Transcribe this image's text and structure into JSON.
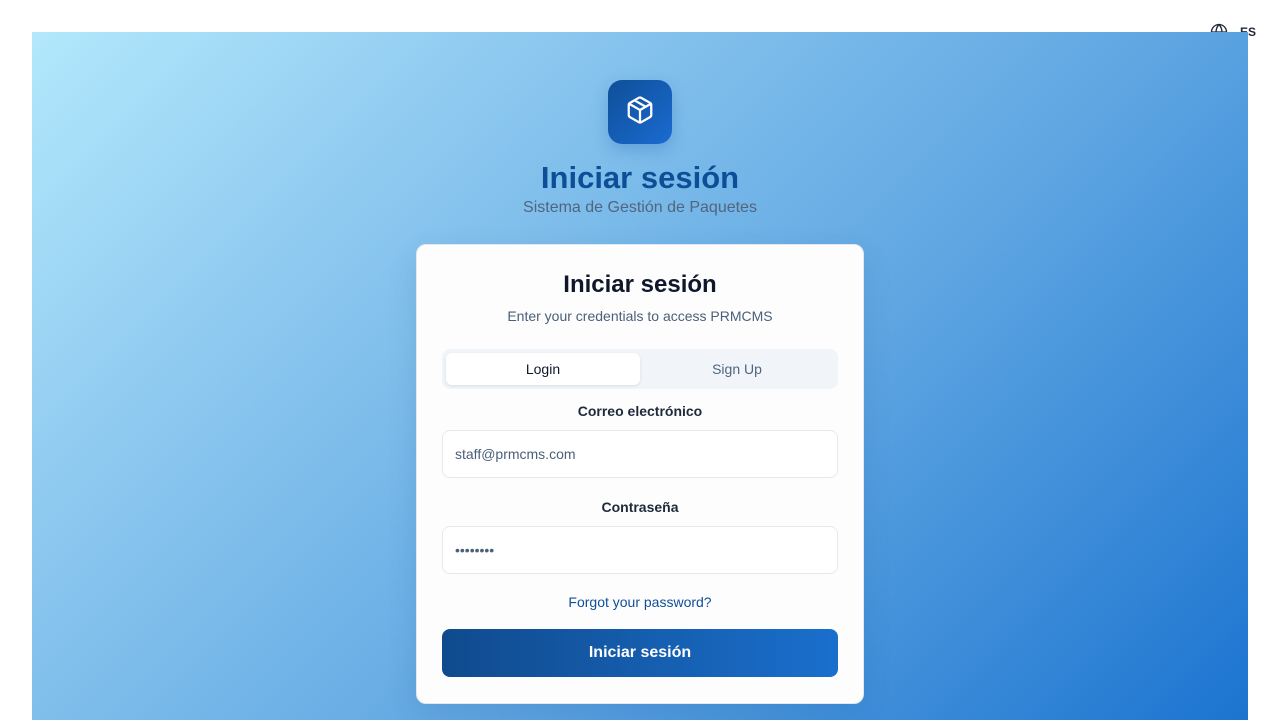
{
  "language": {
    "icon": "globe-icon",
    "code": "ES"
  },
  "brand": {
    "logo_icon": "package-icon",
    "title": "Iniciar sesión",
    "subtitle": "Sistema de Gestión de Paquetes"
  },
  "card": {
    "title": "Iniciar sesión",
    "subtitle": "Enter your credentials to access PRMCMS",
    "tabs": [
      {
        "label": "Login",
        "active": true
      },
      {
        "label": "Sign Up",
        "active": false
      }
    ],
    "email": {
      "label": "Correo electrónico",
      "value": "staff@prmcms.com"
    },
    "password": {
      "label": "Contraseña",
      "value": "password"
    },
    "forgot_label": "Forgot your password?",
    "submit_label": "Iniciar sesión"
  },
  "colors": {
    "primary": "#0f4f99",
    "primary_light": "#1a6fcd",
    "background_gradient_start": "#b3e8fc",
    "background_gradient_end": "#1c74d0"
  }
}
